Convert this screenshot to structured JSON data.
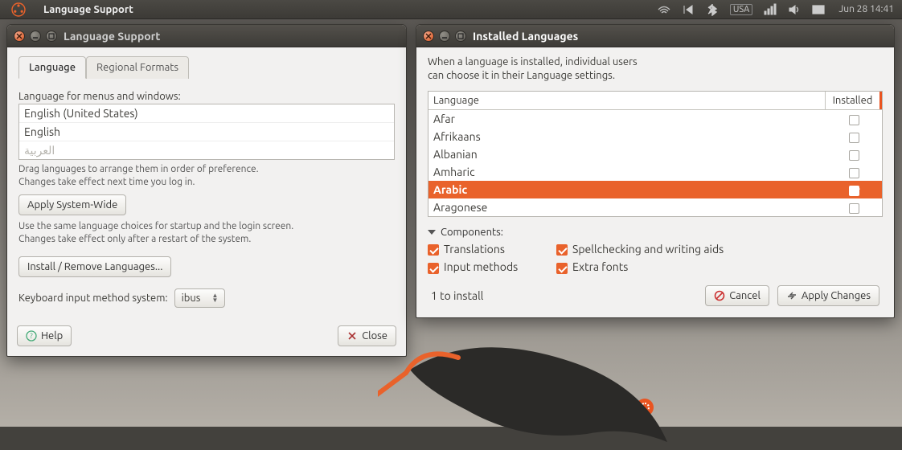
{
  "panel": {
    "app_title": "Language Support",
    "keyboard_indicator": "USA",
    "date": "Jun 28 14:41"
  },
  "win1": {
    "title": "Language Support",
    "tabs": {
      "language": "Language",
      "regional": "Regional Formats"
    },
    "menus_label": "Language for menus and windows:",
    "langs": [
      "English (United States)",
      "English",
      "العربية"
    ],
    "drag_hint": "Drag languages to arrange them in order of preference.\nChanges take effect next time you log in.",
    "apply_sys": "Apply System-Wide",
    "sys_hint": "Use the same language choices for startup and the login screen.\nChanges take effect only after a restart of the system.",
    "install_remove": "Install / Remove Languages...",
    "kbd_label": "Keyboard input method system:",
    "kbd_value": "ibus",
    "help": "Help",
    "close": "Close"
  },
  "win2": {
    "title": "Installed Languages",
    "desc": "When a language is installed, individual users\ncan choose it in their Language settings.",
    "col_lang": "Language",
    "col_inst": "Installed",
    "rows": [
      {
        "name": "Afar",
        "checked": false,
        "selected": false
      },
      {
        "name": "Afrikaans",
        "checked": false,
        "selected": false
      },
      {
        "name": "Albanian",
        "checked": false,
        "selected": false
      },
      {
        "name": "Amharic",
        "checked": false,
        "selected": false
      },
      {
        "name": "Arabic",
        "checked": true,
        "selected": true
      },
      {
        "name": "Aragonese",
        "checked": false,
        "selected": false
      }
    ],
    "components_label": "Components:",
    "comp": {
      "translations": "Translations",
      "spell": "Spellchecking and writing aids",
      "input": "Input methods",
      "fonts": "Extra fonts"
    },
    "status": "1 to install",
    "cancel": "Cancel",
    "apply": "Apply Changes"
  },
  "brand": "ubuntu"
}
